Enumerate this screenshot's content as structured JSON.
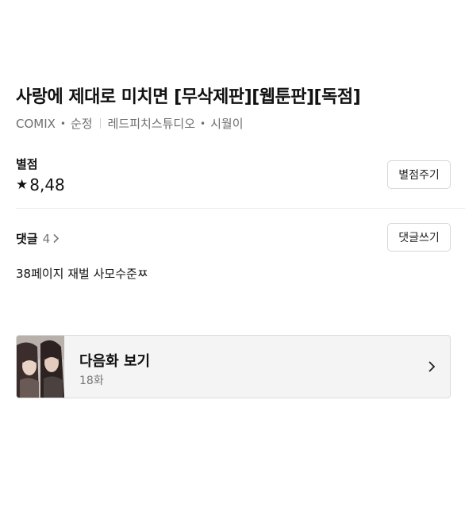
{
  "work": {
    "title": "사랑에 제대로 미치면 [무삭제판][웹툰판][독점]",
    "publisher": "COMIX",
    "genre": "순정",
    "studio": "레드피치스튜디오",
    "author": "시월이"
  },
  "rating": {
    "label": "별점",
    "value": "8,48",
    "button_label": "별점주기"
  },
  "comments": {
    "label": "댓글",
    "count": "4",
    "button_label": "댓글쓰기",
    "latest": "38페이지 재벌 사모수준ㅉ"
  },
  "next_episode": {
    "title": "다음화 보기",
    "episode": "18화"
  },
  "icons": {
    "star": "star-icon",
    "chevron_small": "chevron-right-icon",
    "chevron_card": "chevron-right-icon"
  }
}
